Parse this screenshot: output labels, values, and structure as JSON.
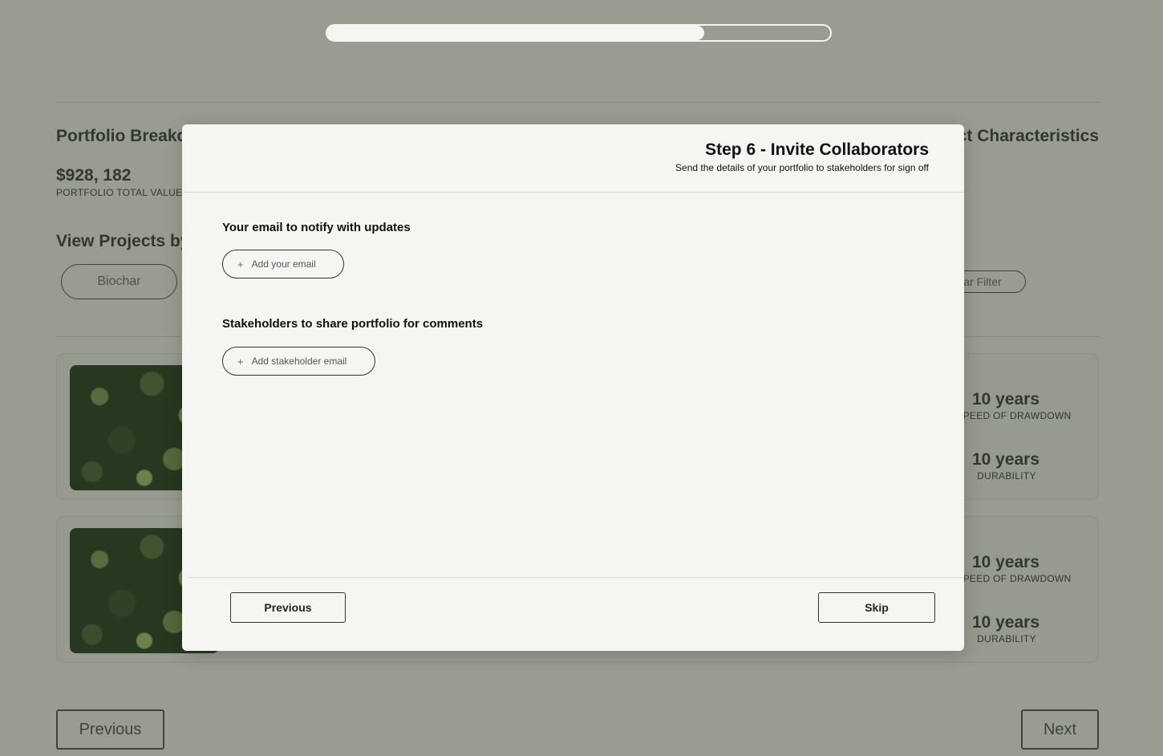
{
  "progress": {
    "fraction": 0.75
  },
  "background": {
    "portfolio_title": "Portfolio Breakdown",
    "characteristics_title": "Project Characteristics",
    "total_value": "$928, 182",
    "total_label": "PORTFOLIO TOTAL VALUE",
    "view_by_title": "View Projects by",
    "filter_biochar": "Biochar",
    "clear_filter": "Clear Filter",
    "cards": [
      {
        "stat1_value": "10 years",
        "stat1_label": "SPEED OF DRAWDOWN",
        "stat2_value": "10 years",
        "stat2_label": "DURABILITY"
      },
      {
        "stat1_value": "10 years",
        "stat1_label": "SPEED OF DRAWDOWN",
        "stat2_value": "10 years",
        "stat2_label": "DURABILITY"
      }
    ],
    "previous_label": "Previous",
    "next_label": "Next"
  },
  "modal": {
    "title": "Step 6 - Invite Collaborators",
    "subtitle": "Send the details of your portfolio to stakeholders for sign off",
    "email_section_label": "Your email to notify with updates",
    "add_email_label": "Add your email",
    "stakeholder_section_label": "Stakeholders to share portfolio for comments",
    "add_stakeholder_label": "Add stakeholder email",
    "previous_label": "Previous",
    "skip_label": "Skip",
    "plus_icon": "plus-icon"
  }
}
